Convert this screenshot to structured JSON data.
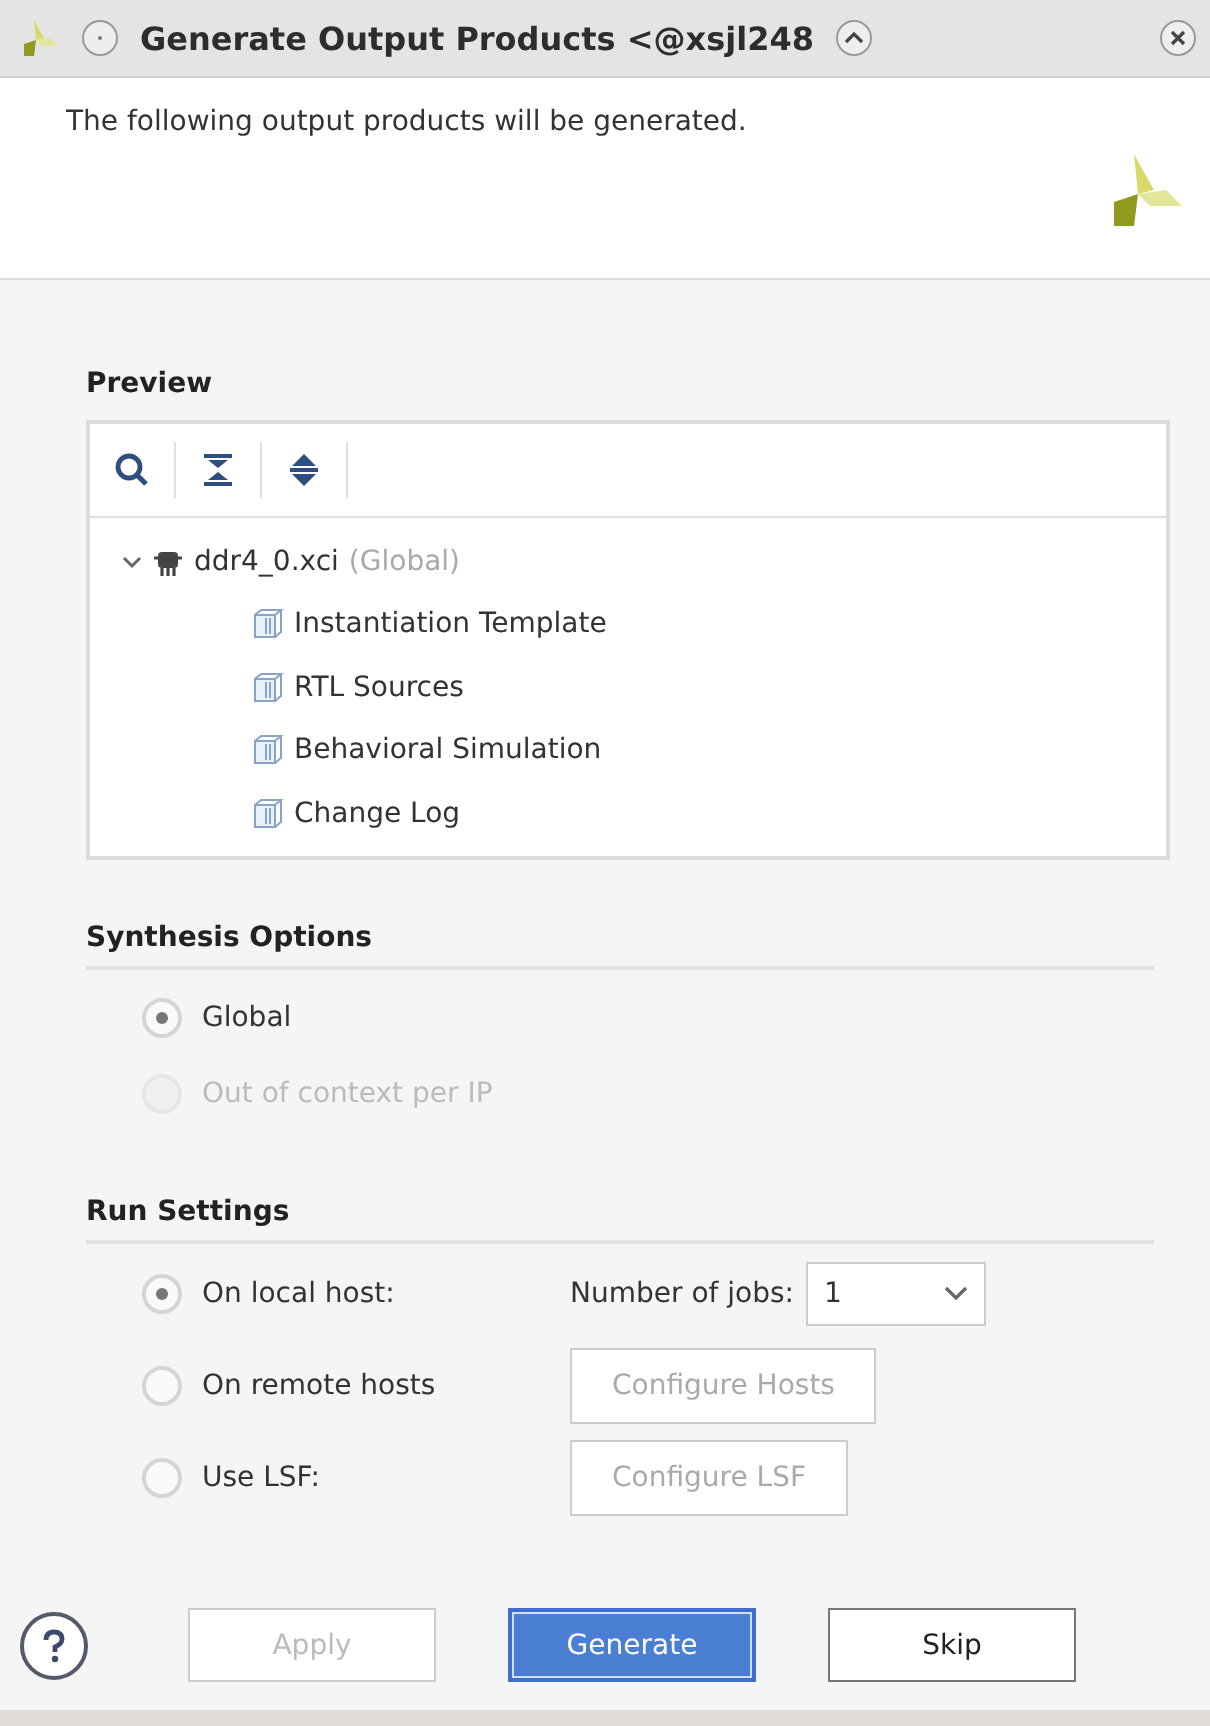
{
  "window": {
    "title": "Generate Output Products <@xsjl248"
  },
  "header": {
    "message": "The following output products will be generated."
  },
  "preview": {
    "label": "Preview",
    "tree": [
      {
        "name": "ddr4_0.xci",
        "note": "(Global)",
        "expanded": true,
        "children": [
          {
            "name": "Instantiation Template"
          },
          {
            "name": "RTL Sources"
          },
          {
            "name": "Behavioral Simulation"
          },
          {
            "name": "Change Log"
          }
        ]
      }
    ]
  },
  "synthesis_options": {
    "label": "Synthesis Options",
    "options": [
      {
        "label": "Global",
        "selected": true,
        "disabled": false
      },
      {
        "label": "Out of context per IP",
        "selected": false,
        "disabled": true
      }
    ]
  },
  "run_settings": {
    "label": "Run Settings",
    "options": [
      {
        "kind": "jobs",
        "label": "On local host:",
        "selected": true,
        "jobs_label": "Number of jobs:",
        "jobs_value": "1"
      },
      {
        "kind": "configure",
        "label": "On remote hosts",
        "selected": false,
        "button": "Configure Hosts",
        "button_disabled": true
      },
      {
        "kind": "configure",
        "label": "Use LSF:",
        "selected": false,
        "button": "Configure LSF",
        "button_disabled": true
      }
    ]
  },
  "buttons": [
    {
      "label": "Apply",
      "disabled": true,
      "default": false
    },
    {
      "label": "Generate",
      "disabled": false,
      "default": true
    },
    {
      "label": "Skip",
      "disabled": false,
      "default": false
    }
  ]
}
